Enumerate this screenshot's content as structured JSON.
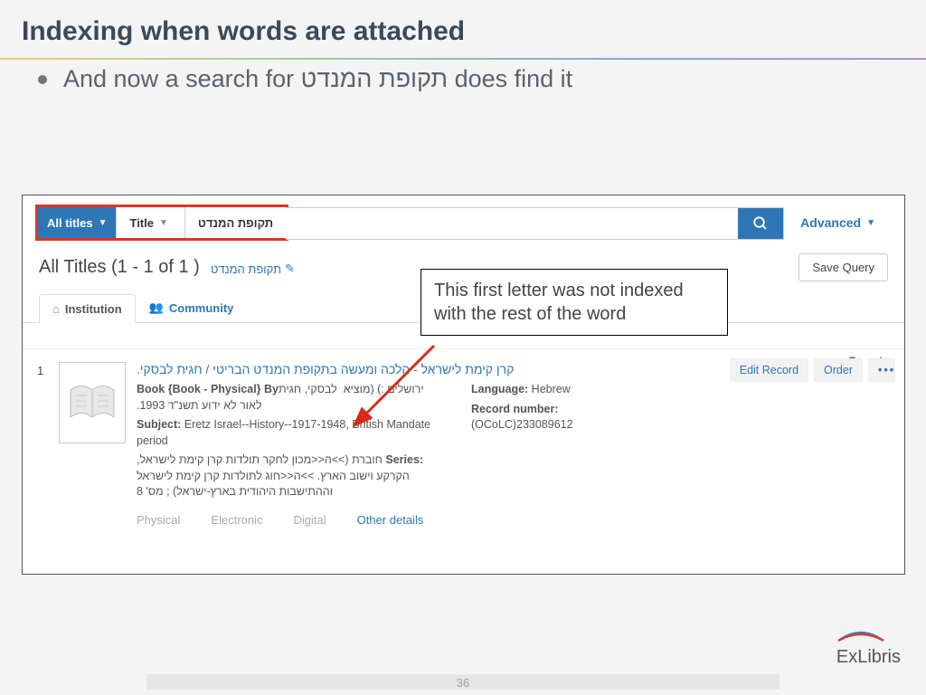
{
  "slide": {
    "title": "Indexing when words are attached",
    "bullet": "And now a search for  תקופת המנדט does find it",
    "page_number": "36",
    "logo_text": "ExLibris"
  },
  "annotation": {
    "text": "This first letter was not indexed with the rest of the word"
  },
  "search": {
    "scope_label": "All titles",
    "field_label": "Title",
    "query": "תקופת המנדט",
    "advanced_label": "Advanced"
  },
  "results": {
    "header": "All Titles (1 - 1 of 1 )",
    "query_chip": "תקופת המנדט",
    "save_query": "Save Query"
  },
  "tabs": {
    "institution": "Institution",
    "community": "Community"
  },
  "record": {
    "index": "1",
    "title": "קרן קימת לישראל - הלכה ומעשה בתקופת המנדט הבריטי / חגית לבסקי.",
    "type_line_prefix": "Book {Book - Physical} By",
    "type_line_author": " לבסקי, חגית",
    "publisher_line": "ירושלים :)  (מוציא לאור לא ידוע תשנ\"ד 1993.",
    "subject_label": "Subject:",
    "subject_value": " Eretz Israel--History--1917-1948, British Mandate period",
    "series_label": "Series:",
    "series_value": " חוברת (>>ה<<מכון לחקר תולדות קרן קימת לישראל, הקרקע וישוב הארץ. >>ה<<חוג לתולדות קרן קימת לישראל וההתישבות היהודית בארץ-ישראל) ; מס' 8",
    "language_label": "Language:",
    "language_value": " Hebrew",
    "recnum_label": "Record number:",
    "recnum_value": "(OCoLC)233089612",
    "fmt_physical": "Physical",
    "fmt_electronic": "Electronic",
    "fmt_digital": "Digital",
    "fmt_other": "Other details",
    "edit": "Edit Record",
    "order": "Order"
  }
}
